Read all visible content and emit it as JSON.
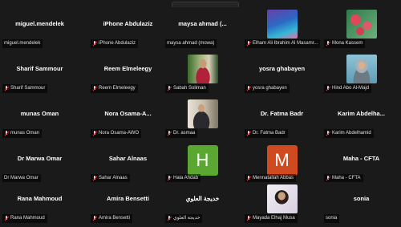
{
  "banner": "MAYSOON is talking...",
  "tiles": [
    {
      "display": "miguel.mendelek",
      "label": "miguel.mendelek"
    },
    {
      "display": "iPhone Abdulaziz",
      "label": "iPhone Abdulaziz"
    },
    {
      "display": "maysa ahmad (...",
      "label": "maysa ahmad (mowa)"
    },
    {
      "display": "",
      "label": "Elham Ali Ibrahim Al Masamr...",
      "photo": "landscape"
    },
    {
      "display": "",
      "label": "Mona Kassem",
      "photo": "flowers"
    },
    {
      "display": "Sharif Sammour",
      "label": "Sharif Sammour"
    },
    {
      "display": "Reem Elmeleegy",
      "label": "Reem Elmeleegy"
    },
    {
      "display": "",
      "label": "Sabah Soliman",
      "photo": "portrait-red"
    },
    {
      "display": "yosra ghabayen",
      "label": "yosra ghabayen"
    },
    {
      "display": "",
      "label": "Hind Abo Al-Majd",
      "photo": "portrait-hijab"
    },
    {
      "display": "munas Oman",
      "label": "munas Oman"
    },
    {
      "display": "Nora Osama-A...",
      "label": "Nora Osama-AWO"
    },
    {
      "display": "",
      "label": "Dr. asmaa",
      "photo": "portrait-suit"
    },
    {
      "display": "Dr. Fatma Badr",
      "label": "Dr. Fatma Badr"
    },
    {
      "display": "Karim  Abdelha...",
      "label": "Karim Abdelhamid"
    },
    {
      "display": "Dr Marwa Omar",
      "label": "Dr Marwa Omar"
    },
    {
      "display": "Sahar Alnaas",
      "label": "Sahar Alnaas"
    },
    {
      "display": "",
      "label": "Hala Ahdab",
      "letter": "H",
      "letter_color": "#5aa832"
    },
    {
      "display": "",
      "label": "Mennatallah Abbas",
      "letter": "M",
      "letter_color": "#d04a1f"
    },
    {
      "display": "Maha - CFTA",
      "label": "Maha - CFTA"
    },
    {
      "display": "Rana Mahmoud",
      "label": "Rana Mahmoud"
    },
    {
      "display": "Amira Bensetti",
      "label": "Amira Bensetti"
    },
    {
      "display": "خديجة العلوي",
      "label": "خديجة العلوي"
    },
    {
      "display": "",
      "label": "Mayada Elhaj Musa",
      "photo": "portrait-dark"
    },
    {
      "display": "sonia",
      "label": "sonia"
    }
  ]
}
